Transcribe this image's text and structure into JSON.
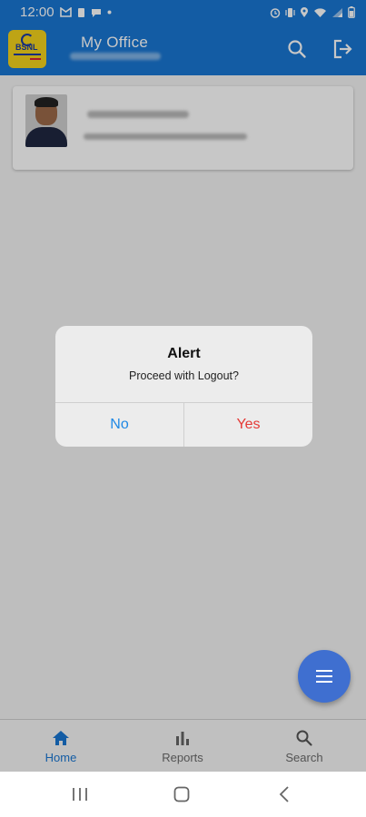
{
  "colors": {
    "primary": "#1976d2",
    "fab": "#3f6fd0",
    "no_button": "#1e88e5",
    "yes_button": "#e53935",
    "nav_active": "#1976d2",
    "nav_inactive": "#6b6b6b"
  },
  "statusbar": {
    "time": "12:00",
    "left_icons": [
      "gmail-icon",
      "sim-icon",
      "chat-icon",
      "dot-icon"
    ],
    "right_icons": [
      "alarm-icon",
      "vibrate-icon",
      "location-icon",
      "wifi-icon",
      "signal-icon",
      "battery-icon"
    ]
  },
  "appbar": {
    "logo_text": "BSNL",
    "title": "My Office",
    "search_icon": "search-icon",
    "logout_icon": "logout-icon"
  },
  "profile_card": {
    "avatar": "avatar"
  },
  "dialog": {
    "title": "Alert",
    "message": "Proceed with Logout?",
    "no_label": "No",
    "yes_label": "Yes"
  },
  "fab": {
    "icon": "menu-icon"
  },
  "bottom_nav": {
    "items": [
      {
        "label": "Home",
        "icon": "home-icon",
        "active": true
      },
      {
        "label": "Reports",
        "icon": "bar-chart-icon",
        "active": false
      },
      {
        "label": "Search",
        "icon": "search-icon",
        "active": false
      }
    ]
  },
  "system_nav": {
    "buttons": [
      "recents-button",
      "home-button",
      "back-button"
    ]
  }
}
